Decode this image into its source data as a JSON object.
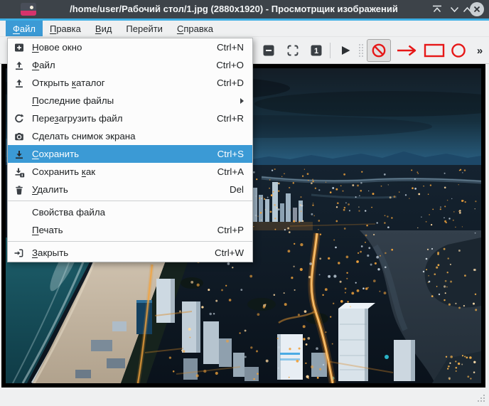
{
  "window": {
    "title": "/home/user/Рабочий стол/1.jpg (2880x1920) - Просмотрщик изображений",
    "controls": [
      "keep-above",
      "minimize",
      "maximize",
      "close"
    ]
  },
  "menubar": {
    "items": [
      {
        "pre": "",
        "mn": "Ф",
        "post": "айл",
        "selected": true
      },
      {
        "pre": "",
        "mn": "П",
        "post": "равка",
        "selected": false
      },
      {
        "pre": "",
        "mn": "В",
        "post": "ид",
        "selected": false
      },
      {
        "pre": "Перейти",
        "mn": "",
        "post": "",
        "selected": false
      },
      {
        "pre": "",
        "mn": "С",
        "post": "правка",
        "selected": false
      }
    ]
  },
  "file_menu": {
    "items": [
      {
        "icon": "new-window",
        "pre": "",
        "mn": "Н",
        "post": "овое окно",
        "shortcut": "Ctrl+N"
      },
      {
        "icon": "open-file",
        "pre": "",
        "mn": "Ф",
        "post": "айл",
        "shortcut": "Ctrl+O"
      },
      {
        "icon": "open-folder",
        "pre": "Открыть ",
        "mn": "к",
        "post": "аталог",
        "shortcut": "Ctrl+D"
      },
      {
        "icon": "",
        "pre": "",
        "mn": "П",
        "post": "оследние файлы",
        "shortcut": "",
        "submenu": true
      },
      {
        "icon": "reload",
        "pre": "Пере",
        "mn": "з",
        "post": "агрузить файл",
        "shortcut": "Ctrl+R"
      },
      {
        "icon": "screenshot",
        "pre": "Сделать снимок экрана",
        "mn": "",
        "post": "",
        "shortcut": ""
      },
      {
        "icon": "save",
        "pre": "",
        "mn": "С",
        "post": "охранить",
        "shortcut": "Ctrl+S",
        "highlighted": true
      },
      {
        "icon": "save-as",
        "pre": "Сохранить ",
        "mn": "к",
        "post": "ак",
        "shortcut": "Ctrl+A"
      },
      {
        "icon": "delete",
        "pre": "",
        "mn": "У",
        "post": "далить",
        "shortcut": "Del"
      },
      {
        "icon": "",
        "pre": "Свойства файла",
        "mn": "",
        "post": "",
        "shortcut": ""
      },
      {
        "icon": "",
        "pre": "",
        "mn": "П",
        "post": "ечать",
        "shortcut": "Ctrl+P"
      },
      {
        "icon": "",
        "pre": "",
        "mn": "З",
        "post": "акрыть",
        "shortcut": "Ctrl+W"
      }
    ]
  },
  "toolbar": {
    "icons": [
      "zoom-out",
      "fit-to-window",
      "actual-size",
      "slideshow-play",
      "drag-handle",
      "annotate-none",
      "annotate-arrow",
      "annotate-rectangle",
      "annotate-ellipse"
    ],
    "overflow_label": "»"
  },
  "colors": {
    "highlight": "#3b9ad5",
    "accent_line": "#3daee4",
    "titlebar": "#3d4349",
    "annotation_red": "#e61717"
  }
}
